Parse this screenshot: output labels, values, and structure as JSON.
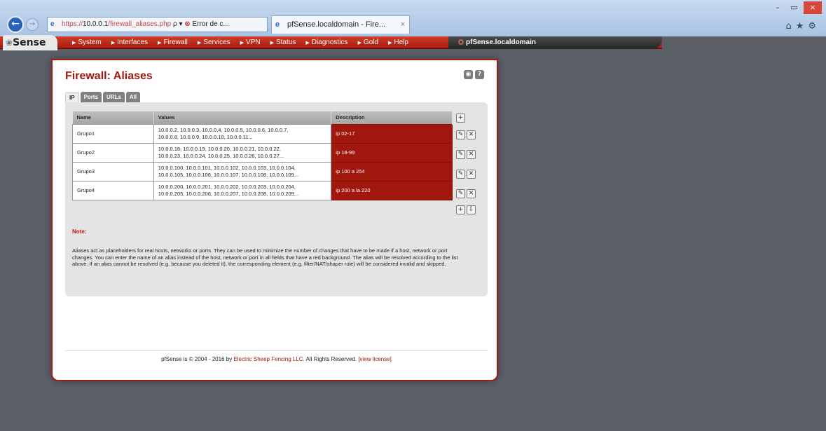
{
  "browser": {
    "url_scheme": "https://",
    "url_host": "10.0.0.1",
    "url_path": "/firewall_aliases.php",
    "address_controls": "ρ ▾",
    "error_label": "Error de c...",
    "tab_title": "pfSense.localdomain - Fire...",
    "tab_close": "×",
    "window_min": "–",
    "window_max": "▭",
    "window_close": "×",
    "toolbar_icons": "⌂★⚙"
  },
  "pfsense": {
    "logo": "Sense",
    "nav_items": [
      "System",
      "Interfaces",
      "Firewall",
      "Services",
      "VPN",
      "Status",
      "Diagnostics",
      "Gold",
      "Help"
    ],
    "hostname": "pfSense.localdomain"
  },
  "page": {
    "title": "Firewall: Aliases",
    "tabs": [
      {
        "label": "IP",
        "active": true
      },
      {
        "label": "Ports",
        "active": false
      },
      {
        "label": "URLs",
        "active": false
      },
      {
        "label": "All",
        "active": false
      }
    ]
  },
  "table": {
    "headers": {
      "name": "Name",
      "values": "Values",
      "description": "Description"
    },
    "rows": [
      {
        "name": "Grupo1",
        "values_line1": "10.0.0.2, 10.0.0.3, 10.0.0.4, 10.0.0.5, 10.0.0.6, 10.0.0.7,",
        "values_line2": "10.0.0.8, 10.0.0.9, 10.0.0.10, 10.0.0.11...",
        "description": "ip 02-17"
      },
      {
        "name": "Grupo2",
        "values_line1": "10.0.0.18, 10.0.0.19, 10.0.0.20, 10.0.0.21, 10.0.0.22,",
        "values_line2": "10.0.0.23, 10.0.0.24, 10.0.0.25, 10.0.0.26, 10.0.0.27...",
        "description": "ip 18-99"
      },
      {
        "name": "Grupo3",
        "values_line1": "10.0.0.100, 10.0.0.101, 10.0.0.102, 10.0.0.103, 10.0.0.104,",
        "values_line2": "10.0.0.105, 10.0.0.106, 10.0.0.107, 10.0.0.108, 10.0.0.109...",
        "description": "ip 100 a 254"
      },
      {
        "name": "Grupo4",
        "values_line1": "10.0.0.200, 10.0.0.201, 10.0.0.202, 10.0.0.203, 10.0.0.204,",
        "values_line2": "10.0.0.205, 10.0.0.206, 10.0.0.207, 10.0.0.208, 10.0.0.209...",
        "description": "ip 200 a la 220"
      }
    ]
  },
  "note": {
    "label": "Note:",
    "text": "Aliases act as placeholders for real hosts, networks or ports. They can be used to minimize the number of changes that have to be made if a host, network or port changes. You can enter the name of an alias instead of the host, network or port in all fields that have a red background. The alias will be resolved according to the list above. If an alias cannot be resolved (e.g. because you deleted it), the corresponding element (e.g. filter/NAT/shaper rule) will be considered invalid and skipped."
  },
  "footer": {
    "prefix": "pfSense is © 2004 - 2016 by",
    "company": "Electric Sheep Fencing LLC.",
    "rights": "All Rights Reserved.",
    "license": "[view license]"
  },
  "colors": {
    "brand_red": "#a1180e",
    "nav_red": "#d23c28",
    "background": "#5b5f66"
  }
}
